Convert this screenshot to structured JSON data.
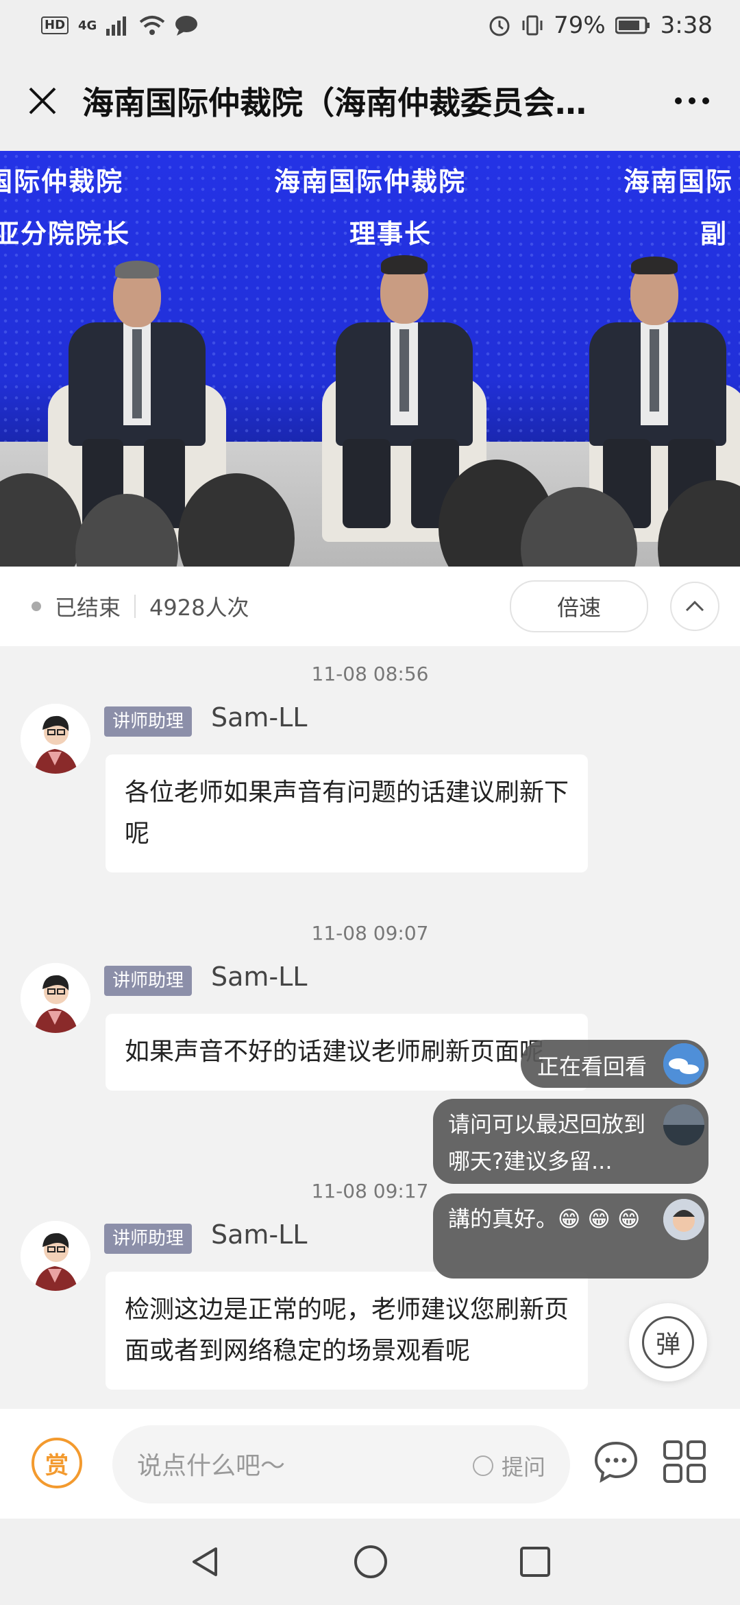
{
  "status_bar": {
    "network": "4G",
    "battery": "79%",
    "time": "3:38"
  },
  "header": {
    "title": "海南国际仲裁院（海南仲裁委员会…"
  },
  "video": {
    "banner": [
      "亚分院院长",
      "理事长",
      "副"
    ],
    "org": [
      "国际仲裁院",
      "海南国际仲裁院",
      "海南国际"
    ]
  },
  "controls": {
    "status": "已结束",
    "views": "4928人次",
    "speed_label": "倍速"
  },
  "chat": [
    {
      "time": "11-08 08:56",
      "badge": "讲师助理",
      "name": "Sam-LL",
      "text": "各位老师如果声音有问题的话建议刷新下呢"
    },
    {
      "time": "11-08 09:07",
      "badge": "讲师助理",
      "name": "Sam-LL",
      "text": "如果声音不好的话建议老师刷新页面呢"
    },
    {
      "time": "11-08 09:17",
      "badge": "讲师助理",
      "name": "Sam-LL",
      "text": "检测这边是正常的呢，老师建议您刷新页面或者到网络稳定的场景观看呢"
    }
  ],
  "danmaku": [
    {
      "text": "正在看回看"
    },
    {
      "text": "请问可以最迟回放到哪天?建议多留..."
    },
    {
      "text": "講的真好。😁 😁 😁"
    }
  ],
  "danmu_toggle": "弹",
  "input": {
    "reward": "赏",
    "placeholder": "说点什么吧～",
    "ask": "提问"
  }
}
